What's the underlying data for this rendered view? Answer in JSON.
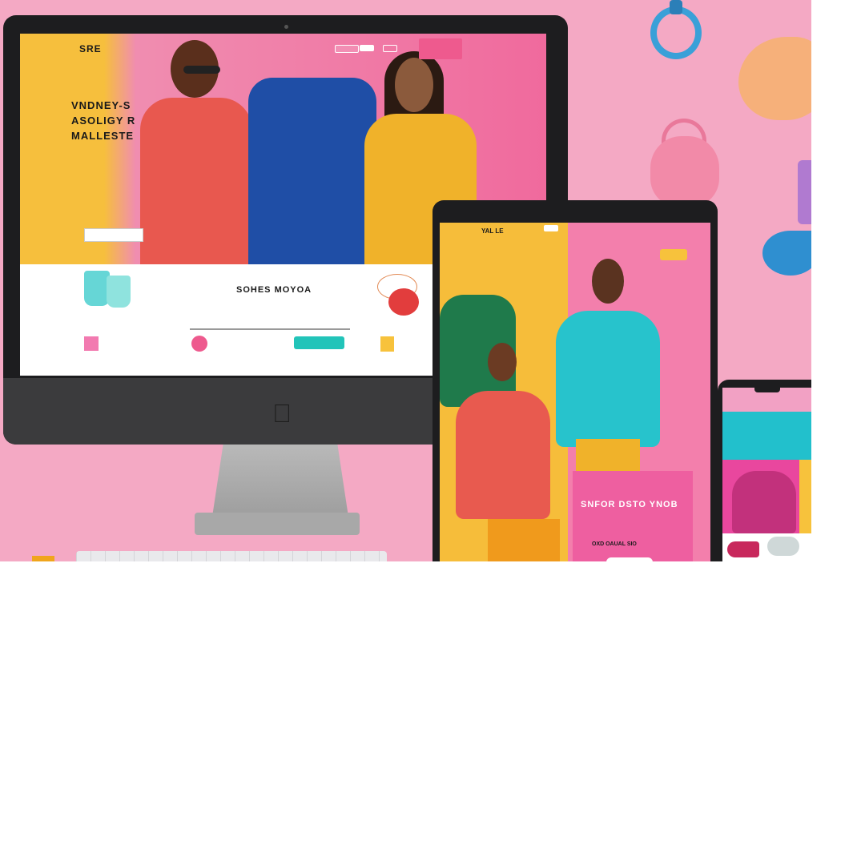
{
  "desktop": {
    "brand": "SRE",
    "hero": {
      "headline_line1": "VNDNEY-S",
      "headline_line2": "ASOLIGY R",
      "headline_line3": "MALLESTE"
    },
    "products": {
      "section_title": "SOHES MOYOA"
    }
  },
  "tablet": {
    "brand": "YAL LE",
    "card_title": "SNFOR DSTO YNOB",
    "card_sub": "OXD OAUAL SIO"
  },
  "colors": {
    "background_pink": "#f4a9c4",
    "hero_yellow": "#f6bf3d",
    "hero_pink": "#f06a9d",
    "accent_teal": "#22c4b9",
    "accent_pink": "#ee5a8e"
  },
  "icons": [
    "apple-logo-icon",
    "search-icon",
    "cart-icon"
  ]
}
